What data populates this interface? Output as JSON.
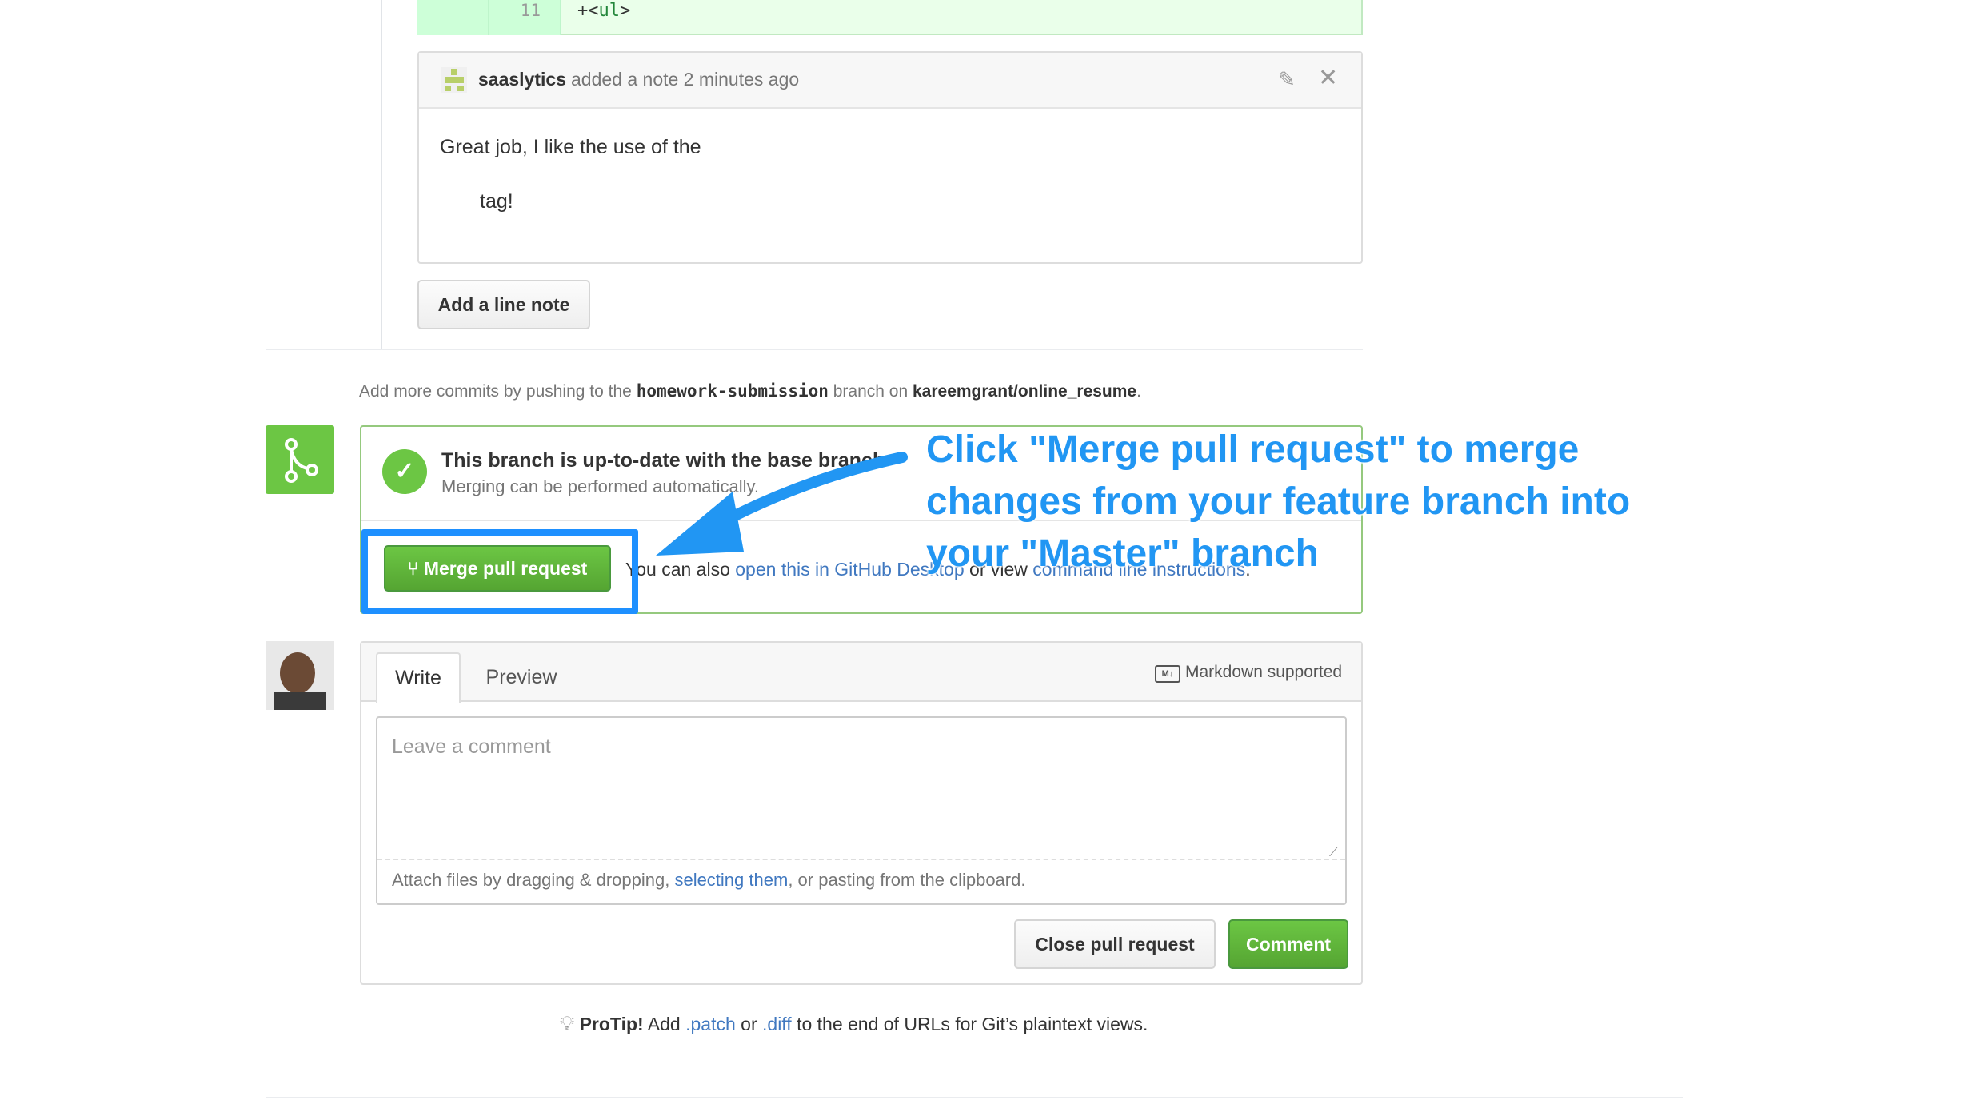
{
  "diff": {
    "line_number": "11",
    "code_prefix": "+<",
    "code_tag": "ul",
    "code_suffix": ">"
  },
  "note": {
    "author": "saaslytics",
    "meta": "added a note 2 minutes ago",
    "body_line1": "Great job, I like the use of the",
    "body_line2": "tag!",
    "edit_icon": "pencil-icon",
    "close_icon": "close-icon"
  },
  "add_line_note_label": "Add a line note",
  "hint": {
    "prefix": "Add more commits by pushing to the",
    "branch": "homework-submission",
    "middle": "branch on",
    "repo": "kareemgrant/online_resume",
    "suffix": "."
  },
  "merge": {
    "title": "This branch is up-to-date with the base branch",
    "subtitle": "Merging can be performed automatically.",
    "button_label": "Merge pull request",
    "alt_prefix": "You can also",
    "alt_link1": "open this in GitHub Desktop",
    "alt_middle": "or view",
    "alt_link2": "command line instructions",
    "alt_suffix": "."
  },
  "annotation": {
    "text": "Click \"Merge pull request\" to merge changes from your feature branch into your \"Master\" branch",
    "color": "#2196f3"
  },
  "comment": {
    "tab_write": "Write",
    "tab_preview": "Preview",
    "markdown_icon": "markdown-icon",
    "markdown_label": "Markdown supported",
    "placeholder": "Leave a comment",
    "attach_prefix": "Attach files by dragging & dropping,",
    "attach_link": "selecting them",
    "attach_suffix": ", or pasting from the clipboard.",
    "close_button": "Close pull request",
    "comment_button": "Comment"
  },
  "protip": {
    "label": "ProTip!",
    "text1": "Add",
    "patch": ".patch",
    "or": "or",
    "diff": ".diff",
    "text2": "to the end of URLs for Git’s plaintext views."
  },
  "colors": {
    "green": "#6cc644",
    "link": "#4078c0",
    "highlight": "#1e90ff"
  }
}
